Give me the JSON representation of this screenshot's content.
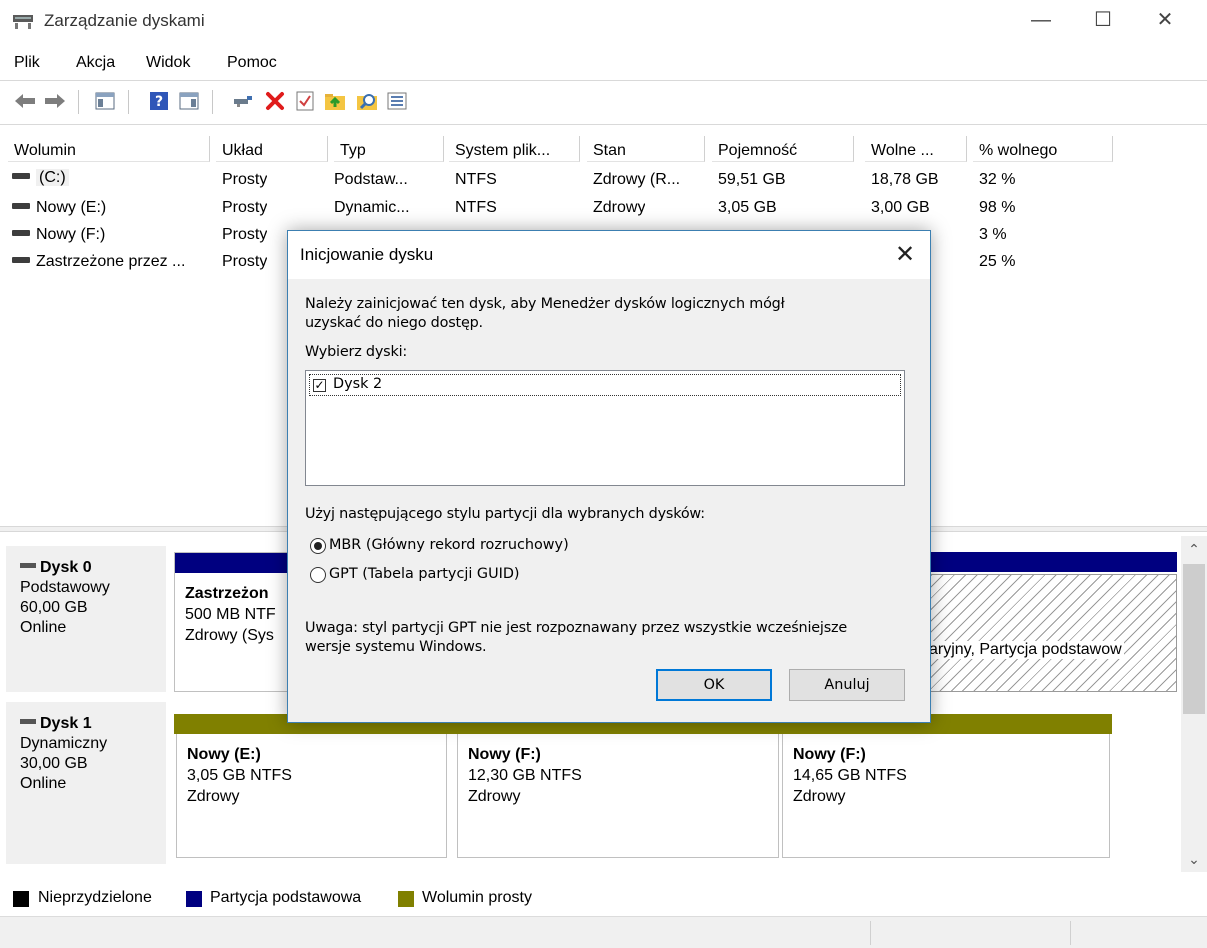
{
  "window": {
    "title": "Zarządzanie dyskami",
    "controls": {
      "minimize": "—",
      "maximize": "☐",
      "close": "✕"
    }
  },
  "menu": [
    "Plik",
    "Akcja",
    "Widok",
    "Pomoc"
  ],
  "toolbar": {
    "icons": [
      "back-icon",
      "forward-icon",
      "console-tree-icon",
      "help-icon",
      "show-pane-icon",
      "connect-icon",
      "delete-icon",
      "properties-icon",
      "up-folder-icon",
      "find-icon",
      "list-view-icon"
    ]
  },
  "volume_list": {
    "columns": [
      "Wolumin",
      "Układ",
      "Typ",
      "System plik...",
      "Stan",
      "Pojemność",
      "Wolne ...",
      "% wolnego"
    ],
    "rows": [
      [
        "(C:)",
        "Prosty",
        "Podstaw...",
        "NTFS",
        "Zdrowy (R...",
        "59,51 GB",
        "18,78 GB",
        "32 %"
      ],
      [
        "Nowy (E:)",
        "Prosty",
        "Dynamic...",
        "NTFS",
        "Zdrowy",
        "3,05 GB",
        "3,00 GB",
        "98 %"
      ],
      [
        "Nowy (F:)",
        "Prosty",
        "",
        "",
        "",
        "",
        "",
        "3 %"
      ],
      [
        "Zastrzeżone przez ...",
        "Prosty",
        "",
        "",
        "",
        "",
        "",
        "25 %"
      ]
    ]
  },
  "disks": [
    {
      "name": "Dysk 0",
      "type": "Podstawowy",
      "size": "60,00 GB",
      "status": "Online",
      "partitions": [
        {
          "name": "Zastrzeżon",
          "size": "500 MB NTF",
          "status": "Zdrowy (Sys"
        },
        {
          "name": "",
          "size": "",
          "status": "varyjny, Partycja podstawow"
        }
      ]
    },
    {
      "name": "Dysk 1",
      "type": "Dynamiczny",
      "size": "30,00 GB",
      "status": "Online",
      "partitions": [
        {
          "name": "Nowy  (E:)",
          "size": "3,05 GB NTFS",
          "status": "Zdrowy"
        },
        {
          "name": "Nowy  (F:)",
          "size": "12,30 GB NTFS",
          "status": "Zdrowy"
        },
        {
          "name": "Nowy  (F:)",
          "size": "14,65 GB NTFS",
          "status": "Zdrowy"
        }
      ]
    }
  ],
  "legend": [
    {
      "label": "Nieprzydzielone",
      "color": "#000000"
    },
    {
      "label": "Partycja podstawowa",
      "color": "#000080"
    },
    {
      "label": "Wolumin prosty",
      "color": "#808000"
    }
  ],
  "dialog": {
    "title": "Inicjowanie dysku",
    "message_line1": "Należy zainicjować ten dysk, aby Menedżer dysków logicznych mógł",
    "message_line2": "uzyskać do niego dostęp.",
    "select_label": "Wybierz dyski:",
    "disk_item": "Dysk 2",
    "disk_item_checked": true,
    "style_label": "Użyj następującego stylu partycji dla wybranych dysków:",
    "option_mbr": "MBR (Główny rekord rozruchowy)",
    "option_gpt": "GPT (Tabela partycji GUID)",
    "selected_option": "MBR",
    "note_line1": "Uwaga: styl partycji GPT nie jest rozpoznawany przez wszystkie wcześniejsze",
    "note_line2": "wersje systemu Windows.",
    "ok": "OK",
    "cancel": "Anuluj"
  },
  "colors": {
    "primary_partition": "#000080",
    "simple_volume": "#808000",
    "dialog_border": "#3c7fb1",
    "default_button_border": "#0078d7"
  }
}
